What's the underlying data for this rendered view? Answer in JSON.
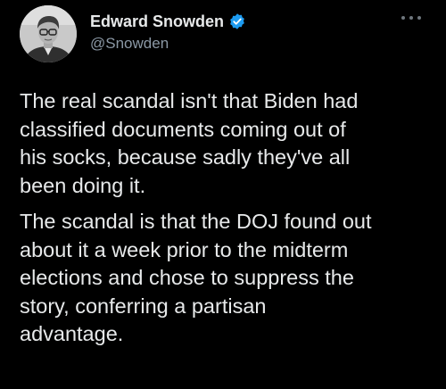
{
  "author": {
    "display_name": "Edward Snowden",
    "handle": "@Snowden",
    "verified": true,
    "verified_badge_color": "#1d9bf0"
  },
  "icons": {
    "avatar": "avatar-photo",
    "verified": "verified-badge-icon",
    "more": "more-options-icon"
  },
  "tweet": {
    "paragraphs": [
      "The real scandal isn't that Biden had\nclassified documents coming out of\nhis socks, because sadly they've all\nbeen doing it.",
      "The scandal is that the DOJ found out\nabout it a week prior to the midterm\nelections and chose to suppress the\nstory, conferring a partisan\nadvantage."
    ]
  },
  "colors": {
    "background": "#000000",
    "text_primary": "#e7e9ea",
    "text_secondary": "#8b98a5"
  }
}
